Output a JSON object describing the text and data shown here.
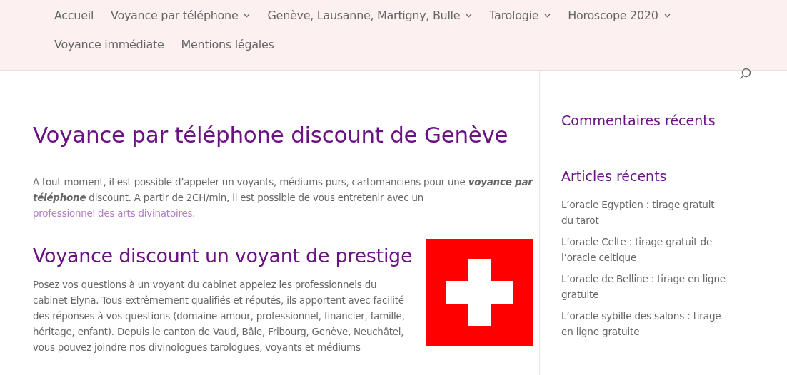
{
  "nav": {
    "items": [
      {
        "label": "Accueil",
        "dropdown": false
      },
      {
        "label": "Voyance par téléphone",
        "dropdown": true
      },
      {
        "label": "Genève, Lausanne, Martigny, Bulle",
        "dropdown": true
      },
      {
        "label": "Tarologie",
        "dropdown": true
      },
      {
        "label": "Horoscope 2020",
        "dropdown": true
      },
      {
        "label": "Voyance immédiate",
        "dropdown": false
      },
      {
        "label": "Mentions légales",
        "dropdown": false
      }
    ]
  },
  "main": {
    "title": "Voyance par téléphone discount de Genève",
    "intro": "A tout moment, il est possible d’appeler un voyants, médiums purs, cartomanciens pour une **voyance par téléphone** discount. A partir de 2CH/min, il est possible de vous entretenir avec un ",
    "intro_link": "professionnel des arts divinatoires",
    "intro_end": ".",
    "subtitle": "Voyance discount un voyant de prestige",
    "paragraph": "Posez vos questions à un voyant du cabinet appelez les professionnels du cabinet Elyna. Tous extrêmement qualifiés et réputés, ils apportent avec facilité des réponses à vos questions (domaine amour, professionnel, financier, famille, héritage, enfant). Depuis le canton de Vaud, Bâle, Fribourg, Genève, Neuchâtel, vous pouvez joindre nos divinologues tarologues, voyants et médiums"
  },
  "sidebar": {
    "widgets": [
      {
        "title": "Commentaires récents"
      },
      {
        "title": "Articles récents",
        "links": [
          "L’oracle Egyptien : tirage gratuit du tarot",
          "L’oracle Celte : tirage gratuit de l’oracle celtique",
          "L’oracle de Belline : tirage en ligne gratuite",
          "L’oracle sybille des salons : tirage en ligne gratuite"
        ]
      }
    ]
  }
}
